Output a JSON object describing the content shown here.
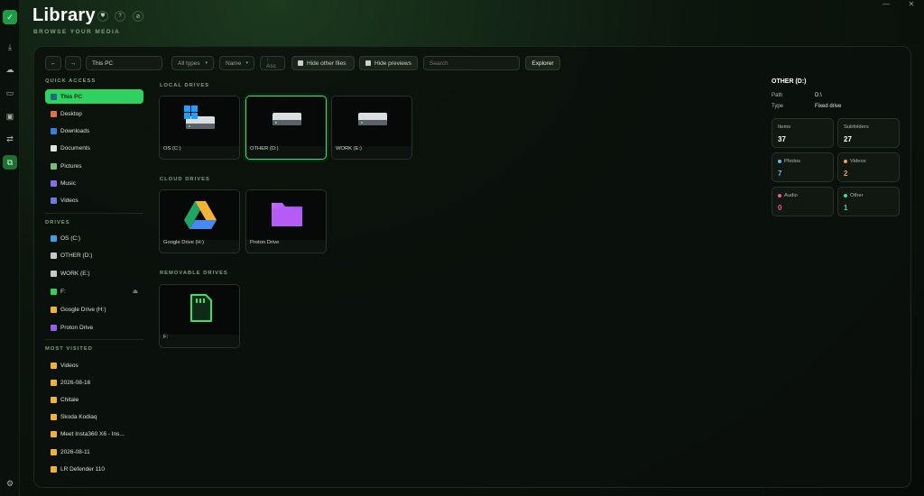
{
  "app": {
    "title": "Library",
    "subtitle": "BROWSE YOUR MEDIA",
    "accent": "#2fd15f"
  },
  "header_buttons": [
    {
      "icon": "shield-icon",
      "glyph": "⛊"
    },
    {
      "icon": "help-icon",
      "glyph": "?"
    },
    {
      "icon": "eye-off-icon",
      "glyph": "⊘"
    }
  ],
  "window_controls": {
    "minimize": "—",
    "close": "✕"
  },
  "rail": {
    "logo": "✓",
    "items": [
      {
        "icon": "download-icon",
        "glyph": "⤓"
      },
      {
        "icon": "cloud-icon",
        "glyph": "☁"
      },
      {
        "icon": "folder-icon",
        "glyph": "▭"
      },
      {
        "icon": "media-icon",
        "glyph": "▣"
      },
      {
        "icon": "transfer-icon",
        "glyph": "⇄"
      },
      {
        "icon": "library-icon",
        "glyph": "⧉"
      }
    ],
    "settings": "⚙"
  },
  "toolbar": {
    "back": "←",
    "forward": "→",
    "path_value": "This PC",
    "type_filter": "All types",
    "sort": "Name",
    "order": "↑ Asc",
    "hide_other_files": "Hide other files",
    "hide_previews": "Hide previews",
    "search_placeholder": "Search",
    "explorer": "Explorer"
  },
  "sidebar": {
    "quick_access_title": "QUICK ACCESS",
    "quick_access": [
      {
        "label": "This PC",
        "color": "#1d6a86"
      },
      {
        "label": "Desktop",
        "color": "#e0704a"
      },
      {
        "label": "Downloads",
        "color": "#3a7de0"
      },
      {
        "label": "Documents",
        "color": "#dfe4df"
      },
      {
        "label": "Pictures",
        "color": "#7bbd72"
      },
      {
        "label": "Music",
        "color": "#8a6de0"
      },
      {
        "label": "Videos",
        "color": "#6d7ae0"
      }
    ],
    "drives_title": "DRIVES",
    "drives": [
      {
        "label": "OS (C:)",
        "color": "#3aa0e6"
      },
      {
        "label": "OTHER (D:)",
        "color": "#c8c8c8"
      },
      {
        "label": "WORK (E:)",
        "color": "#c8c8c8"
      },
      {
        "label": "F:",
        "color": "#2fd15f"
      },
      {
        "label": "Google Drive (H:)",
        "color": "#f2b233"
      },
      {
        "label": "Proton Drive",
        "color": "#9b5cf0"
      }
    ],
    "eject_glyph": "⏏",
    "most_visited_title": "MOST VISITED",
    "most_visited": [
      {
        "label": "Videos"
      },
      {
        "label": "2026-08-16"
      },
      {
        "label": "Chitale"
      },
      {
        "label": "Skoda Kodiaq"
      },
      {
        "label": "Meet Insta360 X6 - Ins..."
      },
      {
        "label": "2026-08-11"
      },
      {
        "label": "LR Defender 110"
      }
    ]
  },
  "content": {
    "local_title": "LOCAL DRIVES",
    "local": [
      {
        "label": "OS (C:)"
      },
      {
        "label": "OTHER (D:)"
      },
      {
        "label": "WORK (E:)"
      }
    ],
    "cloud_title": "CLOUD DRIVES",
    "cloud": [
      {
        "label": "Google Drive (H:)"
      },
      {
        "label": "Proton Drive"
      }
    ],
    "removable_title": "REMOVABLE DRIVES",
    "removable": [
      {
        "label": "F:"
      }
    ]
  },
  "details": {
    "title": "OTHER (D:)",
    "path_label": "Path",
    "path_value": "D:\\",
    "type_label": "Type",
    "type_value": "Fixed drive",
    "stats": [
      {
        "label": "Items",
        "value": "37",
        "color": "#ffffff",
        "dot": ""
      },
      {
        "label": "Subfolders",
        "value": "27",
        "color": "#ffffff",
        "dot": ""
      },
      {
        "label": "Photos",
        "value": "7",
        "color": "#5fb8f0",
        "dot": "#5fb8f0"
      },
      {
        "label": "Videos",
        "value": "2",
        "color": "#f0a040",
        "dot": "#f0a040"
      },
      {
        "label": "Audio",
        "value": "0",
        "color": "#f05a9a",
        "dot": "#f05a9a"
      },
      {
        "label": "Other",
        "value": "1",
        "color": "#3fdc8e",
        "dot": "#3fdc8e"
      }
    ]
  }
}
